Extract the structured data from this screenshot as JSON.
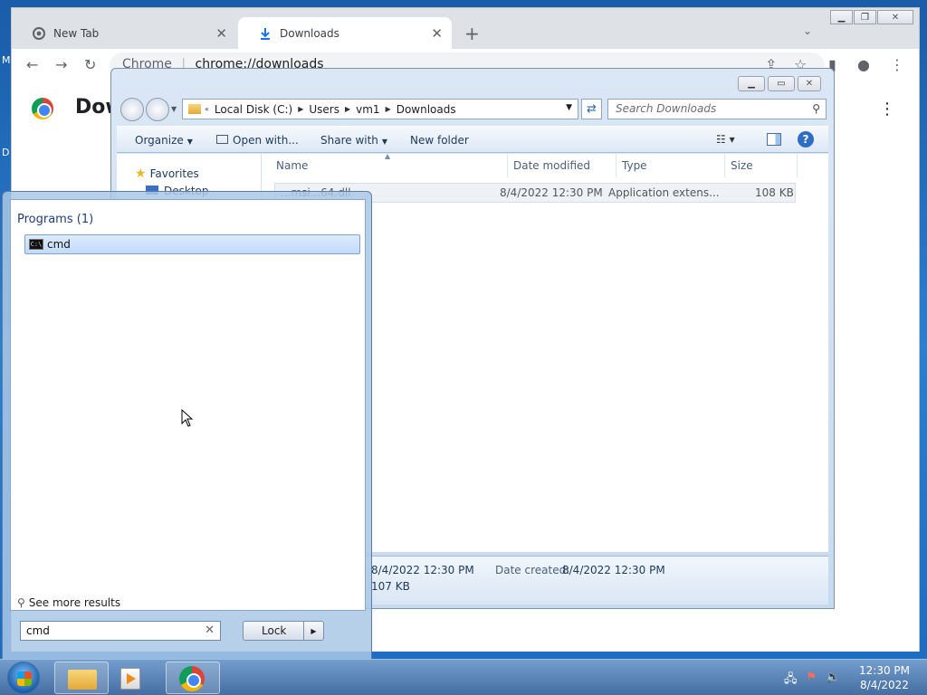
{
  "desktop": {
    "letter_m": "M",
    "letter_d": "D"
  },
  "chrome": {
    "tabs": [
      {
        "label": "New Tab",
        "icon": "chrome-icon"
      },
      {
        "label": "Downloads",
        "icon": "download-icon"
      }
    ],
    "omnibox": {
      "scheme": "Chrome",
      "url": "chrome://downloads"
    },
    "page_heading": "Dow"
  },
  "explorer": {
    "breadcrumb": [
      "Local Disk (C:)",
      "Users",
      "vm1",
      "Downloads"
    ],
    "search_placeholder": "Search Downloads",
    "commands": {
      "organize": "Organize",
      "open_with": "Open with...",
      "share_with": "Share with",
      "new_folder": "New folder"
    },
    "nav": {
      "favorites": "Favorites",
      "desktop": "Desktop"
    },
    "columns": {
      "name": "Name",
      "date_modified": "Date modified",
      "type": "Type",
      "size": "Size"
    },
    "files": [
      {
        "name": "...msi...64.dll",
        "date_modified": "8/4/2022 12:30 PM",
        "type": "Application extens...",
        "size": "108 KB"
      }
    ],
    "details": {
      "date_modified_value": "8/4/2022 12:30 PM",
      "size_value": "107 KB",
      "date_created_label": "Date created:",
      "date_created_value": "8/4/2022 12:30 PM"
    }
  },
  "start_menu": {
    "programs_heading": "Programs (1)",
    "result": "cmd",
    "see_more": "See more results",
    "search_value": "cmd",
    "lock_label": "Lock"
  },
  "taskbar": {
    "clock_time": "12:30 PM",
    "clock_date": "8/4/2022"
  }
}
